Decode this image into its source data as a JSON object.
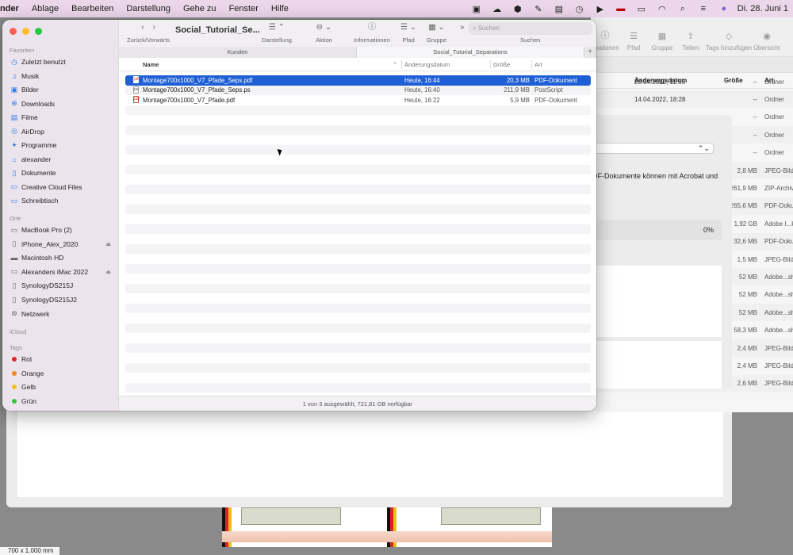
{
  "menubar": {
    "app": "nder",
    "menus": [
      "Ablage",
      "Bearbeiten",
      "Darstellung",
      "Gehe zu",
      "Fenster",
      "Hilfe"
    ],
    "clock": "Di. 28. Juni 1"
  },
  "window": {
    "title": "Social_Tutorial_Se...",
    "toolbar": {
      "back_forward": "Zurück/Vorwärts",
      "view": "Darstellung",
      "action": "Aktion",
      "info": "Informationen",
      "path": "Pfad",
      "group": "Gruppe",
      "search_label": "Suchen",
      "search_placeholder": "Suchen"
    },
    "tabs": [
      {
        "label": "Kunden",
        "active": false
      },
      {
        "label": "Social_Tutorial_Separations",
        "active": true
      }
    ],
    "columns": {
      "name": "Name",
      "date": "Änderungsdatum",
      "size": "Größe",
      "kind": "Art"
    },
    "files": [
      {
        "name": "Montage700x1000_V7_Pfade_Seps.pdf",
        "date": "Heute, 16:44",
        "size": "20,3 MB",
        "kind": "PDF-Dokument",
        "selected": true,
        "icon": "pdf-icon"
      },
      {
        "name": "Montage700x1000_V7_Pfade_Seps.ps",
        "date": "Heute, 16:40",
        "size": "211,9 MB",
        "kind": "PostScript",
        "selected": false,
        "icon": "ps-icon"
      },
      {
        "name": "Montage700x1000_V7_Pfade.pdf",
        "date": "Heute, 16:22",
        "size": "5,9 MB",
        "kind": "PDF-Dokument",
        "selected": false,
        "icon": "pdf-icon"
      }
    ],
    "status": "1 von 3 ausgewählt, 721,81 GB verfügbar"
  },
  "sidebar": {
    "favorites_title": "Favoriten",
    "favorites": [
      {
        "label": "Zuletzt benutzt",
        "icon": "clock-icon"
      },
      {
        "label": "Musik",
        "icon": "music-icon"
      },
      {
        "label": "Bilder",
        "icon": "photo-icon"
      },
      {
        "label": "Downloads",
        "icon": "download-icon"
      },
      {
        "label": "Filme",
        "icon": "film-icon"
      },
      {
        "label": "AirDrop",
        "icon": "airdrop-icon"
      },
      {
        "label": "Programme",
        "icon": "apps-icon"
      },
      {
        "label": "alexander",
        "icon": "home-icon"
      },
      {
        "label": "Dokumente",
        "icon": "document-icon"
      },
      {
        "label": "Creative Cloud Files",
        "icon": "folder-icon"
      },
      {
        "label": "Schreibtisch",
        "icon": "desktop-icon"
      }
    ],
    "locations_title": "Orte",
    "locations": [
      {
        "label": "MacBook Pro (2)",
        "icon": "laptop-icon",
        "eject": false
      },
      {
        "label": "iPhone_Alex_2020",
        "icon": "phone-icon",
        "eject": true
      },
      {
        "label": "Macintosh HD",
        "icon": "disk-icon",
        "eject": false
      },
      {
        "label": "Alexanders iMac 2022",
        "icon": "imac-icon",
        "eject": true
      },
      {
        "label": "SynologyDS215J",
        "icon": "server-icon",
        "eject": false
      },
      {
        "label": "SynologyDS215J2",
        "icon": "server-icon",
        "eject": false
      },
      {
        "label": "Netzwerk",
        "icon": "network-icon",
        "eject": false
      }
    ],
    "icloud_title": "iCloud",
    "tags_title": "Tags",
    "tags": [
      {
        "label": "Rot",
        "color": "#e5252a"
      },
      {
        "label": "Orange",
        "color": "#f28b1d"
      },
      {
        "label": "Gelb",
        "color": "#f2c21a"
      },
      {
        "label": "Grün",
        "color": "#3ac43b"
      }
    ]
  },
  "background_window": {
    "toolbar": [
      "rmationen",
      "Pfad",
      "Gruppe",
      "Teilen",
      "Tags hinzufügen",
      "Übersicht"
    ],
    "columns": {
      "date": "Änderungsdatum",
      "size": "Größe",
      "kind": "Art"
    },
    "rows": [
      {
        "date": "20.04.2022, 11:56",
        "size": "--",
        "kind": "Ordner"
      },
      {
        "date": "14.04.2022, 18:28",
        "size": "--",
        "kind": "Ordner"
      },
      {
        "date": "",
        "size": "--",
        "kind": "Ordner"
      },
      {
        "date": "",
        "size": "--",
        "kind": "Ordner"
      },
      {
        "date": "",
        "size": "--",
        "kind": "Ordner"
      },
      {
        "date": "",
        "size": "2,8 MB",
        "kind": "JPEG-Bild"
      },
      {
        "date": "",
        "size": "261,9 MB",
        "kind": "ZIP-Archiv"
      },
      {
        "date": "",
        "size": "265,6 MB",
        "kind": "PDF-Doku"
      },
      {
        "date": "",
        "size": "1,92 GB",
        "kind": "Adobe I...k"
      },
      {
        "date": "",
        "size": "32,6 MB",
        "kind": "PDF-Doku"
      },
      {
        "date": "",
        "size": "1,5 MB",
        "kind": "JPEG-Bild"
      },
      {
        "date": "",
        "size": "52 MB",
        "kind": "Adobe...sh"
      },
      {
        "date": "",
        "size": "52 MB",
        "kind": "Adobe...sh"
      },
      {
        "date": "",
        "size": "52 MB",
        "kind": "Adobe...sh"
      },
      {
        "date": "",
        "size": "58,3 MB",
        "kind": "Adobe...sh"
      },
      {
        "date": "",
        "size": "2,4 MB",
        "kind": "JPEG-Bild"
      },
      {
        "date": "",
        "size": "2,4 MB",
        "kind": "JPEG-Bild"
      },
      {
        "date": "",
        "size": "2,6 MB",
        "kind": "JPEG-Bild"
      }
    ],
    "panel_message": "DF-Dokumente können mit Acrobat und",
    "progress": "0%"
  },
  "document_size": "700 x 1.000 mm"
}
